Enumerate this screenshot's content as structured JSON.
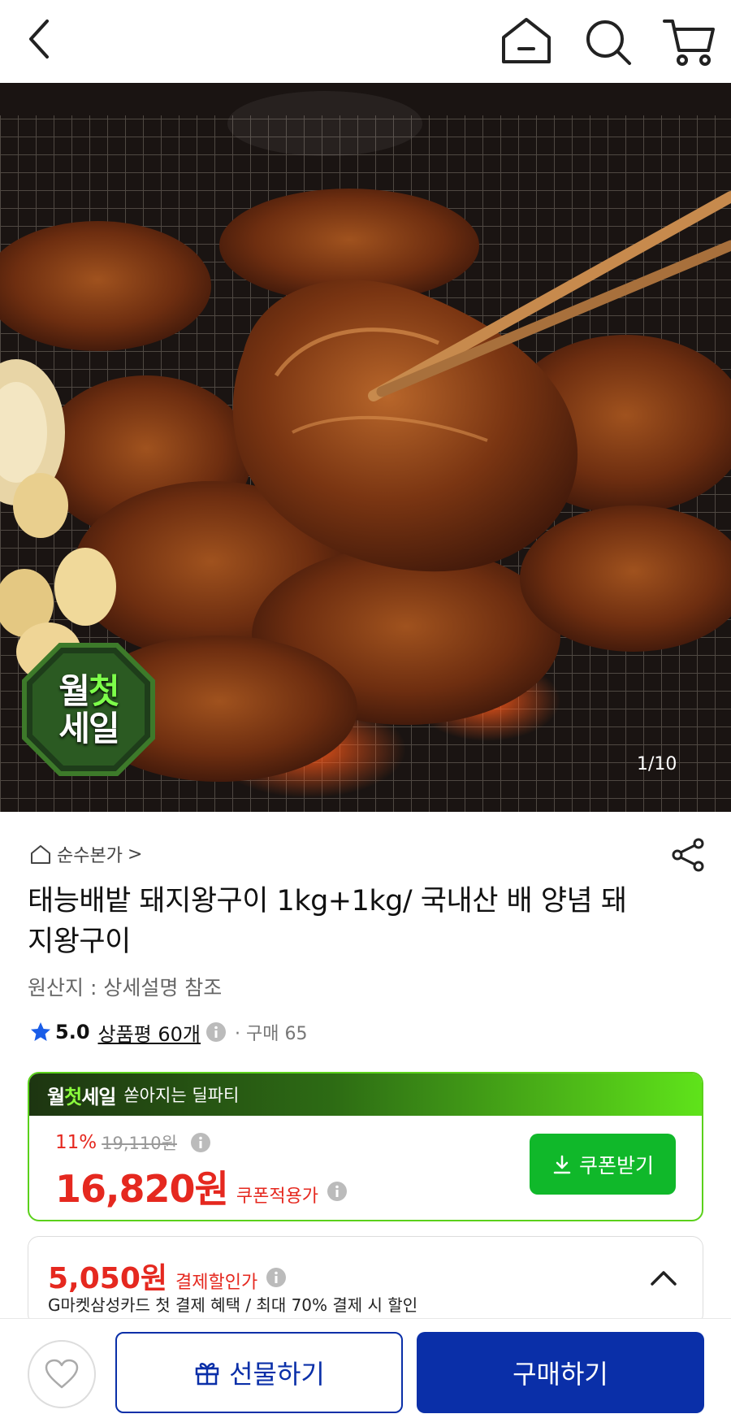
{
  "header": {
    "icons": [
      "back-icon",
      "home-icon",
      "search-icon",
      "cart-icon"
    ]
  },
  "hero": {
    "badge_line1_a": "월",
    "badge_line1_b": "첫",
    "badge_line2": "세일",
    "image_counter": "1/10"
  },
  "product": {
    "store_name": "순수본가",
    "store_chevron": ">",
    "title": "태능배밭 돼지왕구이 1kg+1kg/ 국내산 배 양념 돼지왕구이",
    "origin": "원산지 : 상세설명 참조",
    "rating": "5.0",
    "reviews": "상품평 60개",
    "sold": "· 구매 65"
  },
  "deal": {
    "logo_a": "월",
    "logo_b": "첫",
    "logo_c": "세일",
    "subtitle": "쏟아지는 딜파티",
    "discount_rate": "11%",
    "original_price": "19,110원",
    "price": "16,820원",
    "price_label": "쿠폰적용가",
    "coupon_button": "쿠폰받기"
  },
  "card_offer": {
    "price": "5,050원",
    "label": "결제할인가",
    "description": "G마켓삼성카드 첫 결제 혜택 / 최대 70% 결제 시 할인"
  },
  "bottom": {
    "gift_label": "선물하기",
    "buy_label": "구매하기"
  },
  "colors": {
    "accent_blue": "#0a2fa8",
    "price_red": "#e5281f",
    "deal_green": "#5bd11b",
    "coupon_green": "#10b82a"
  }
}
